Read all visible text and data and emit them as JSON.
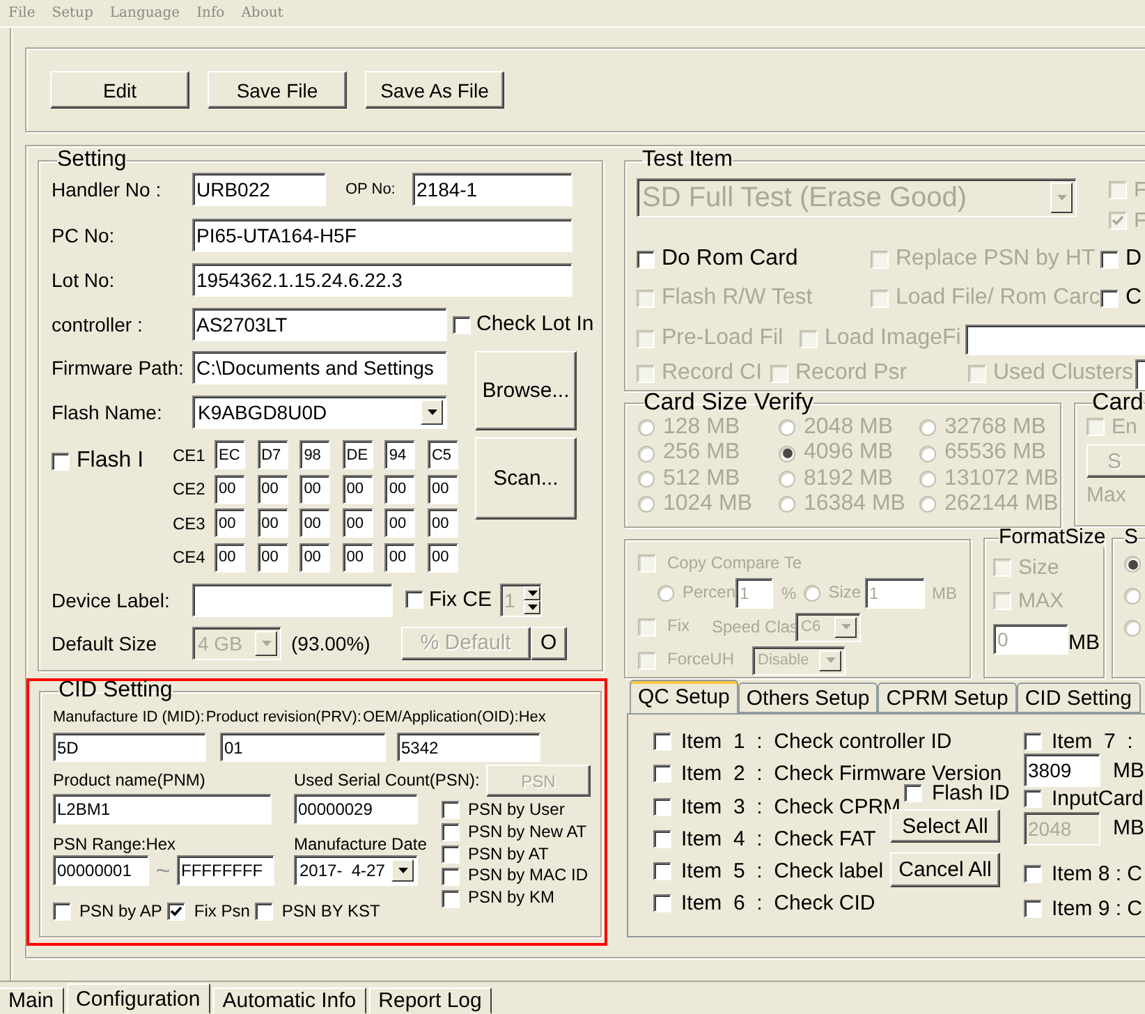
{
  "menu": [
    "File",
    "Setup",
    "Language",
    "Info",
    "About"
  ],
  "toolbar": [
    "Edit",
    "Save File",
    "Save As File"
  ],
  "setting": {
    "title": "Setting",
    "handler_no": {
      "label": "Handler No :",
      "value": "URB022"
    },
    "op_no": {
      "label": "OP No:",
      "value": "2184-1"
    },
    "pc_no": {
      "label": "PC No:",
      "value": "PI65-UTA164-H5F"
    },
    "lot_no": {
      "label": "Lot No:",
      "value": "1954362.1.15.24.6.22.3"
    },
    "controller": {
      "label": "controller :",
      "value": "AS2703LT"
    },
    "check_lot_in": {
      "label": "Check Lot In",
      "checked": false
    },
    "firmware_path": {
      "label": "Firmware Path:",
      "value": "C:\\Documents and Settings"
    },
    "browse_button": "Browse...",
    "flash_name": {
      "label": "Flash Name:",
      "value": "K9ABGD8U0D"
    },
    "flash_id": {
      "label": "Flash I",
      "checked": false
    },
    "ce_rows": [
      {
        "label": "CE1",
        "cells": [
          "EC",
          "D7",
          "98",
          "DE",
          "94",
          "C5"
        ]
      },
      {
        "label": "CE2",
        "cells": [
          "00",
          "00",
          "00",
          "00",
          "00",
          "00"
        ]
      },
      {
        "label": "CE3",
        "cells": [
          "00",
          "00",
          "00",
          "00",
          "00",
          "00"
        ]
      },
      {
        "label": "CE4",
        "cells": [
          "00",
          "00",
          "00",
          "00",
          "00",
          "00"
        ]
      }
    ],
    "scan_button": "Scan...",
    "device_label": {
      "label": "Device Label:"
    },
    "fix_ce": {
      "label": "Fix CE",
      "checked": false
    },
    "ce_count": {
      "value": "1",
      "disabled": true
    },
    "default_size": {
      "label": "Default Size",
      "value": "4 GB",
      "disabled": true
    },
    "default_percent": "(93.00%)",
    "default_button": {
      "label": "% Default",
      "disabled": true
    },
    "o_button": "O"
  },
  "cid": {
    "title": "CID Setting",
    "id_labels": [
      "Manufacture ID (MID):",
      "Product revision(PRV):",
      "OEM/Application(OID):Hex"
    ],
    "id_values": [
      "5D",
      "01",
      "5342"
    ],
    "pnm": {
      "label": "Product name(PNM)",
      "value": "L2BM1"
    },
    "psn_count": {
      "label": "Used Serial Count(PSN):",
      "value": "00000029"
    },
    "psn_button": {
      "label": "PSN",
      "disabled": true
    },
    "psn_range": {
      "label": "PSN Range:Hex",
      "from": "00000001",
      "separator": "~",
      "to": "FFFFFFFF"
    },
    "date": {
      "label": "Manufacture Date",
      "value": "2017-  4-27"
    },
    "options": [
      {
        "label": "PSN by AP",
        "checked": false
      },
      {
        "label": "Fix Psn",
        "checked": true
      },
      {
        "label": "PSN BY KST",
        "checked": false
      }
    ],
    "psn_sources": [
      {
        "label": "PSN by User",
        "checked": false
      },
      {
        "label": "PSN by New AT",
        "checked": false
      },
      {
        "label": "PSN by AT",
        "checked": false
      },
      {
        "label": "PSN by MAC ID",
        "checked": false
      },
      {
        "label": "PSN by KM",
        "checked": false
      }
    ]
  },
  "test_item": {
    "title": "Test Item",
    "mode": {
      "value": "SD Full Test (Erase Good)",
      "disabled": true
    },
    "side_checks": [
      {
        "label": "F",
        "checked": false,
        "disabled": true
      },
      {
        "label": "F",
        "checked": true,
        "disabled": true
      }
    ],
    "rows": [
      [
        {
          "kind": "check",
          "label": "Do Rom Card",
          "checked": false,
          "disabled": false
        },
        {
          "kind": "check",
          "label": "Replace PSN by HT",
          "checked": false,
          "disabled": true
        },
        {
          "kind": "check",
          "label": "D",
          "checked": false,
          "disabled": false
        }
      ],
      [
        {
          "kind": "check",
          "label": "Flash R/W Test",
          "checked": false,
          "disabled": true
        },
        {
          "kind": "check",
          "label": "Load File/ Rom Carc",
          "checked": false,
          "disabled": true
        },
        {
          "kind": "check",
          "label": "C",
          "checked": false,
          "disabled": false
        }
      ],
      [
        {
          "kind": "check",
          "label": "Pre-Load Fil",
          "checked": false,
          "disabled": true
        },
        {
          "kind": "check",
          "label": "Load ImageFi",
          "checked": false,
          "disabled": true
        },
        {
          "kind": "field"
        }
      ],
      [
        {
          "kind": "check",
          "label": "Record CI",
          "checked": false,
          "disabled": true
        },
        {
          "kind": "check",
          "label": "Record Psr",
          "checked": false,
          "disabled": true
        },
        {
          "kind": "check",
          "label": "Used Clusters",
          "checked": false,
          "disabled": true
        },
        {
          "kind": "field"
        }
      ]
    ]
  },
  "card_size": {
    "title": "Card Size Verify",
    "disabled": true,
    "options": [
      {
        "label": "128 MB",
        "selected": false
      },
      {
        "label": "2048 MB",
        "selected": false
      },
      {
        "label": "32768 MB",
        "selected": false
      },
      {
        "label": "256 MB",
        "selected": false
      },
      {
        "label": "4096 MB",
        "selected": true
      },
      {
        "label": "65536 MB",
        "selected": false
      },
      {
        "label": "512 MB",
        "selected": false
      },
      {
        "label": "8192 MB",
        "selected": false
      },
      {
        "label": "131072 MB",
        "selected": false
      },
      {
        "label": "1024 MB",
        "selected": false
      },
      {
        "label": "16384 MB",
        "selected": false
      },
      {
        "label": "262144 MB",
        "selected": false
      }
    ]
  },
  "card_s": {
    "title": "Card",
    "enable": {
      "label": "En",
      "checked": false
    },
    "button": "S",
    "max_label": "Max"
  },
  "copy": {
    "disabled": true,
    "compare": {
      "label": "Copy Compare Te",
      "checked": false
    },
    "percent": {
      "label": "Percen",
      "selected": false,
      "value": "1",
      "unit": "%"
    },
    "size": {
      "label": "Size",
      "selected": false,
      "value": "1",
      "unit": "MB"
    },
    "fix": {
      "label": "Fix",
      "checked": false
    },
    "speed_class": {
      "label": "Speed Clas",
      "value": "C6"
    },
    "force_uhs": {
      "label": "ForceUH",
      "checked": false,
      "value": "Disable"
    }
  },
  "format_size": {
    "title": "FormatSize",
    "checks": [
      {
        "label": "Size",
        "checked": false,
        "disabled": true
      },
      {
        "label": "MAX",
        "checked": false,
        "disabled": true
      }
    ],
    "value": "0",
    "unit": "MB"
  },
  "sd": {
    "title": "S",
    "options": [
      {
        "selected": true
      },
      {
        "selected": false
      },
      {
        "selected": false
      }
    ]
  },
  "qc_tabs": [
    {
      "label": "QC Setup",
      "selected": true
    },
    {
      "label": "Others Setup",
      "selected": false
    },
    {
      "label": "CPRM Setup",
      "selected": false
    },
    {
      "label": "CID Setting",
      "selected": false
    }
  ],
  "qc": {
    "items": [
      {
        "label": "Item  1  :  Check controller ID",
        "checked": false
      },
      {
        "label": "Item  2  :  Check Firmware Version",
        "checked": false
      },
      {
        "label": "Item  3  :  Check CPRM",
        "checked": false
      },
      {
        "label": "Item  4  :  Check FAT",
        "checked": false
      },
      {
        "label": "Item  5  :  Check label",
        "checked": false
      },
      {
        "label": "Item  6  :  Check CID",
        "checked": false
      }
    ],
    "flash_id": {
      "label": "Flash ID",
      "checked": false
    },
    "select_all": "Select All",
    "cancel_all": "Cancel All",
    "item7": {
      "label": "Item  7  :",
      "checked": false
    },
    "item7_value": "3809",
    "item7_unit": "MB",
    "input_card": {
      "label": "InputCard",
      "checked": false
    },
    "input_card_value": "2048",
    "input_card_unit": "MB",
    "extra": [
      {
        "label": "Item 8 : C",
        "checked": false
      },
      {
        "label": "Item 9 : C",
        "checked": false
      }
    ]
  },
  "bottom_tabs": [
    {
      "label": "Main",
      "selected": false
    },
    {
      "label": "Configuration",
      "selected": true
    },
    {
      "label": "Automatic Info",
      "selected": false
    },
    {
      "label": "Report Log",
      "selected": false
    }
  ]
}
